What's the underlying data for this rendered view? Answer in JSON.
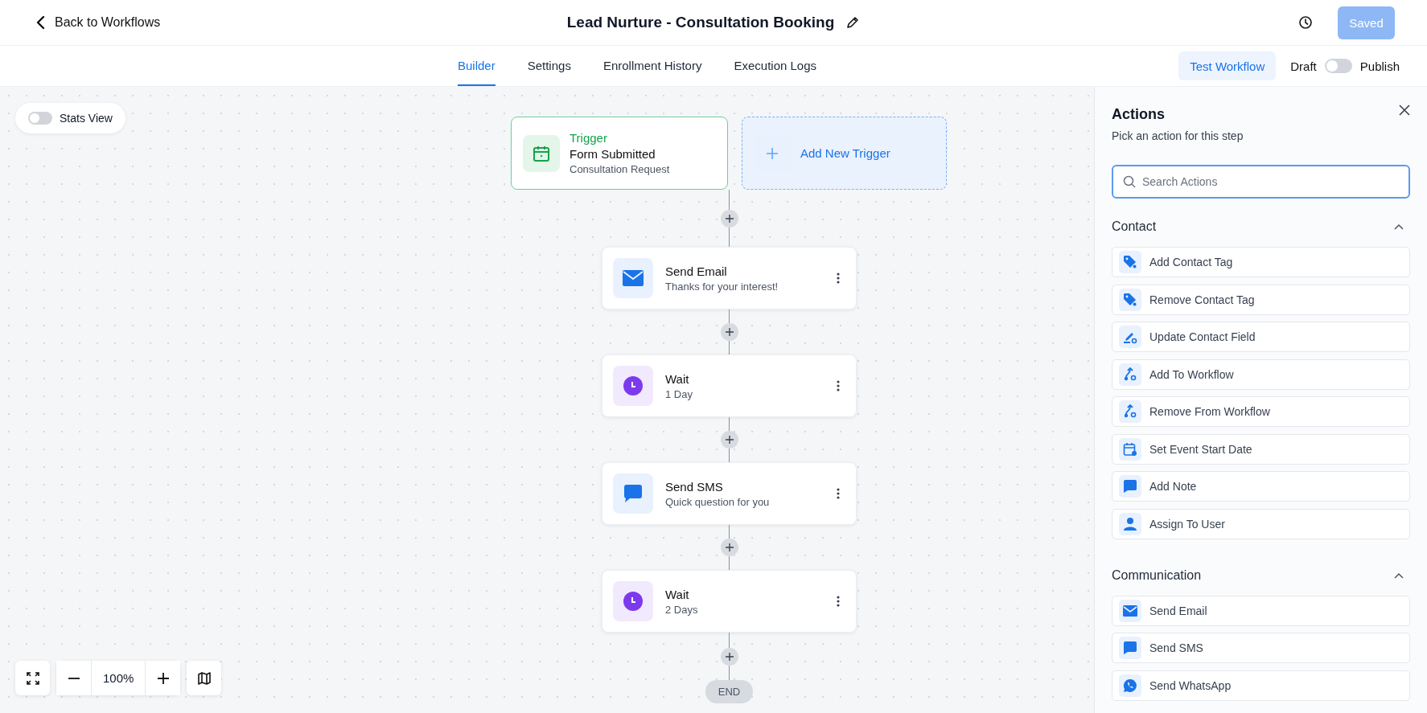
{
  "header": {
    "back_link": "Back to Workflows",
    "title": "Lead Nurture - Consultation Booking",
    "saved_button": {
      "label": "Saved",
      "disabled": true
    }
  },
  "tabs": [
    {
      "label": "Builder",
      "selected": true
    },
    {
      "label": "Settings",
      "selected": false
    },
    {
      "label": "Enrollment History",
      "selected": false
    },
    {
      "label": "Execution Logs",
      "selected": false
    }
  ],
  "test_button": "Test Workflow",
  "publish_toggle": {
    "off_label": "Draft",
    "on_label": "Publish",
    "on": false
  },
  "stats_view": {
    "label": "Stats View",
    "on": false
  },
  "trigger": {
    "label": "Trigger",
    "title": "Form Submitted",
    "subtitle": "Consultation Request"
  },
  "add_trigger": "Add New Trigger",
  "steps": [
    {
      "kind": "email",
      "title": "Send Email",
      "subtitle": "Thanks for your interest!"
    },
    {
      "kind": "wait",
      "title": "Wait",
      "subtitle": "1 Day"
    },
    {
      "kind": "sms",
      "title": "Send SMS",
      "subtitle": "Quick question for you"
    },
    {
      "kind": "wait",
      "title": "Wait",
      "subtitle": "2 Days"
    }
  ],
  "end_label": "END",
  "zoom_level": "100%",
  "panel": {
    "title": "Actions",
    "subtitle": "Pick an action for this step",
    "search": {
      "placeholder": "Search Actions"
    },
    "sections": [
      {
        "name": "Contact",
        "expanded": true,
        "items": [
          {
            "kind": "tag",
            "label": "Add Contact Tag"
          },
          {
            "kind": "tag",
            "label": "Remove Contact Tag"
          },
          {
            "kind": "edit",
            "label": "Update Contact Field"
          },
          {
            "kind": "flow",
            "label": "Add To Workflow"
          },
          {
            "kind": "flow",
            "label": "Remove From Workflow"
          },
          {
            "kind": "calendar",
            "label": "Set Event Start Date"
          },
          {
            "kind": "note",
            "label": "Add Note"
          },
          {
            "kind": "user",
            "label": "Assign To User"
          }
        ]
      },
      {
        "name": "Communication",
        "expanded": true,
        "items": [
          {
            "kind": "email",
            "label": "Send Email"
          },
          {
            "kind": "note",
            "label": "Send SMS"
          },
          {
            "kind": "whatsapp",
            "label": "Send WhatsApp"
          }
        ]
      }
    ]
  }
}
